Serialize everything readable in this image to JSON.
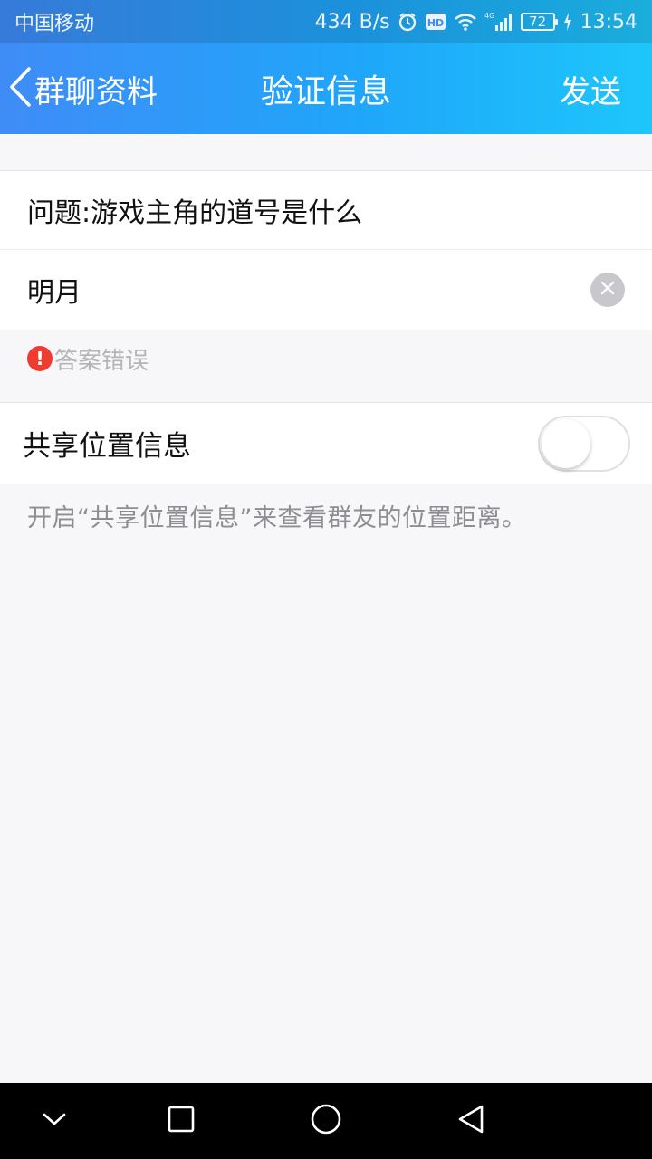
{
  "status_bar": {
    "carrier": "中国移动",
    "net_speed": "434 B/s",
    "network": "4G",
    "battery": "72",
    "time": "13:54",
    "icons": [
      "alarm-icon",
      "hd-icon",
      "wifi-icon",
      "signal-icon",
      "battery-icon",
      "charging-icon"
    ]
  },
  "nav": {
    "back_label": "群聊资料",
    "title": "验证信息",
    "send_label": "发送"
  },
  "form": {
    "question": "问题:游戏主角的道号是什么",
    "answer_value": "明月",
    "error_text": "答案错误"
  },
  "location": {
    "label": "共享位置信息",
    "enabled": false,
    "hint": "开启“共享位置信息”来查看群友的位置距离。"
  },
  "system_nav": {
    "icons": [
      "collapse-icon",
      "recents-icon",
      "home-icon",
      "back-icon"
    ]
  },
  "colors": {
    "header_gradient_start": "#3f8cf7",
    "header_gradient_end": "#1ec6fb",
    "error": "#ee3c30",
    "background": "#f7f7f9"
  }
}
